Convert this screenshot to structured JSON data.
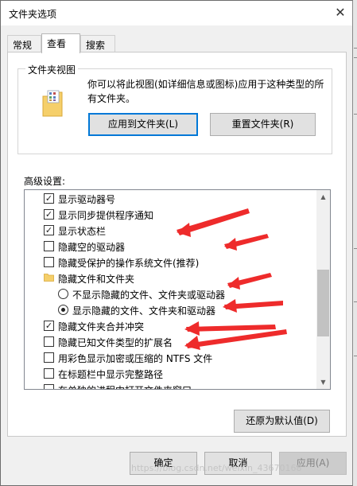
{
  "window": {
    "title": "文件夹选项",
    "close_glyph": "✕"
  },
  "tabs": [
    {
      "label": "常规",
      "active": false
    },
    {
      "label": "查看",
      "active": true
    },
    {
      "label": "搜索",
      "active": false
    }
  ],
  "folder_view": {
    "legend": "文件夹视图",
    "description": "你可以将此视图(如详细信息或图标)应用于这种类型的所有文件夹。",
    "apply_button": "应用到文件夹(L)",
    "reset_button": "重置文件夹(R)"
  },
  "advanced": {
    "label": "高级设置:",
    "items": [
      {
        "type": "checkbox",
        "checked": true,
        "label": "显示驱动器号"
      },
      {
        "type": "checkbox",
        "checked": true,
        "label": "显示同步提供程序通知"
      },
      {
        "type": "checkbox",
        "checked": true,
        "label": "显示状态栏"
      },
      {
        "type": "checkbox",
        "checked": false,
        "label": "隐藏空的驱动器"
      },
      {
        "type": "checkbox",
        "checked": false,
        "label": "隐藏受保护的操作系统文件(推荐)"
      },
      {
        "type": "folder",
        "label": "隐藏文件和文件夹"
      },
      {
        "type": "radio",
        "checked": false,
        "label": "不显示隐藏的文件、文件夹或驱动器"
      },
      {
        "type": "radio",
        "checked": true,
        "label": "显示隐藏的文件、文件夹和驱动器"
      },
      {
        "type": "checkbox",
        "checked": true,
        "label": "隐藏文件夹合并冲突"
      },
      {
        "type": "checkbox",
        "checked": false,
        "label": "隐藏已知文件类型的扩展名"
      },
      {
        "type": "checkbox",
        "checked": false,
        "label": "用彩色显示加密或压缩的 NTFS 文件"
      },
      {
        "type": "checkbox",
        "checked": false,
        "label": "在标题栏中显示完整路径"
      },
      {
        "type": "checkbox",
        "checked": false,
        "label": "在单独的进程中打开文件夹窗口"
      }
    ],
    "restore_defaults_button": "还原为默认值(D)"
  },
  "footer": {
    "ok_button": "确定",
    "cancel_button": "取消",
    "apply_button": "应用(A)"
  },
  "watermark": "https://blog.csdn.net/weixin_43670168",
  "colors": {
    "annotation_arrow": "#ee2b2b",
    "focus_border": "#0078d7"
  }
}
